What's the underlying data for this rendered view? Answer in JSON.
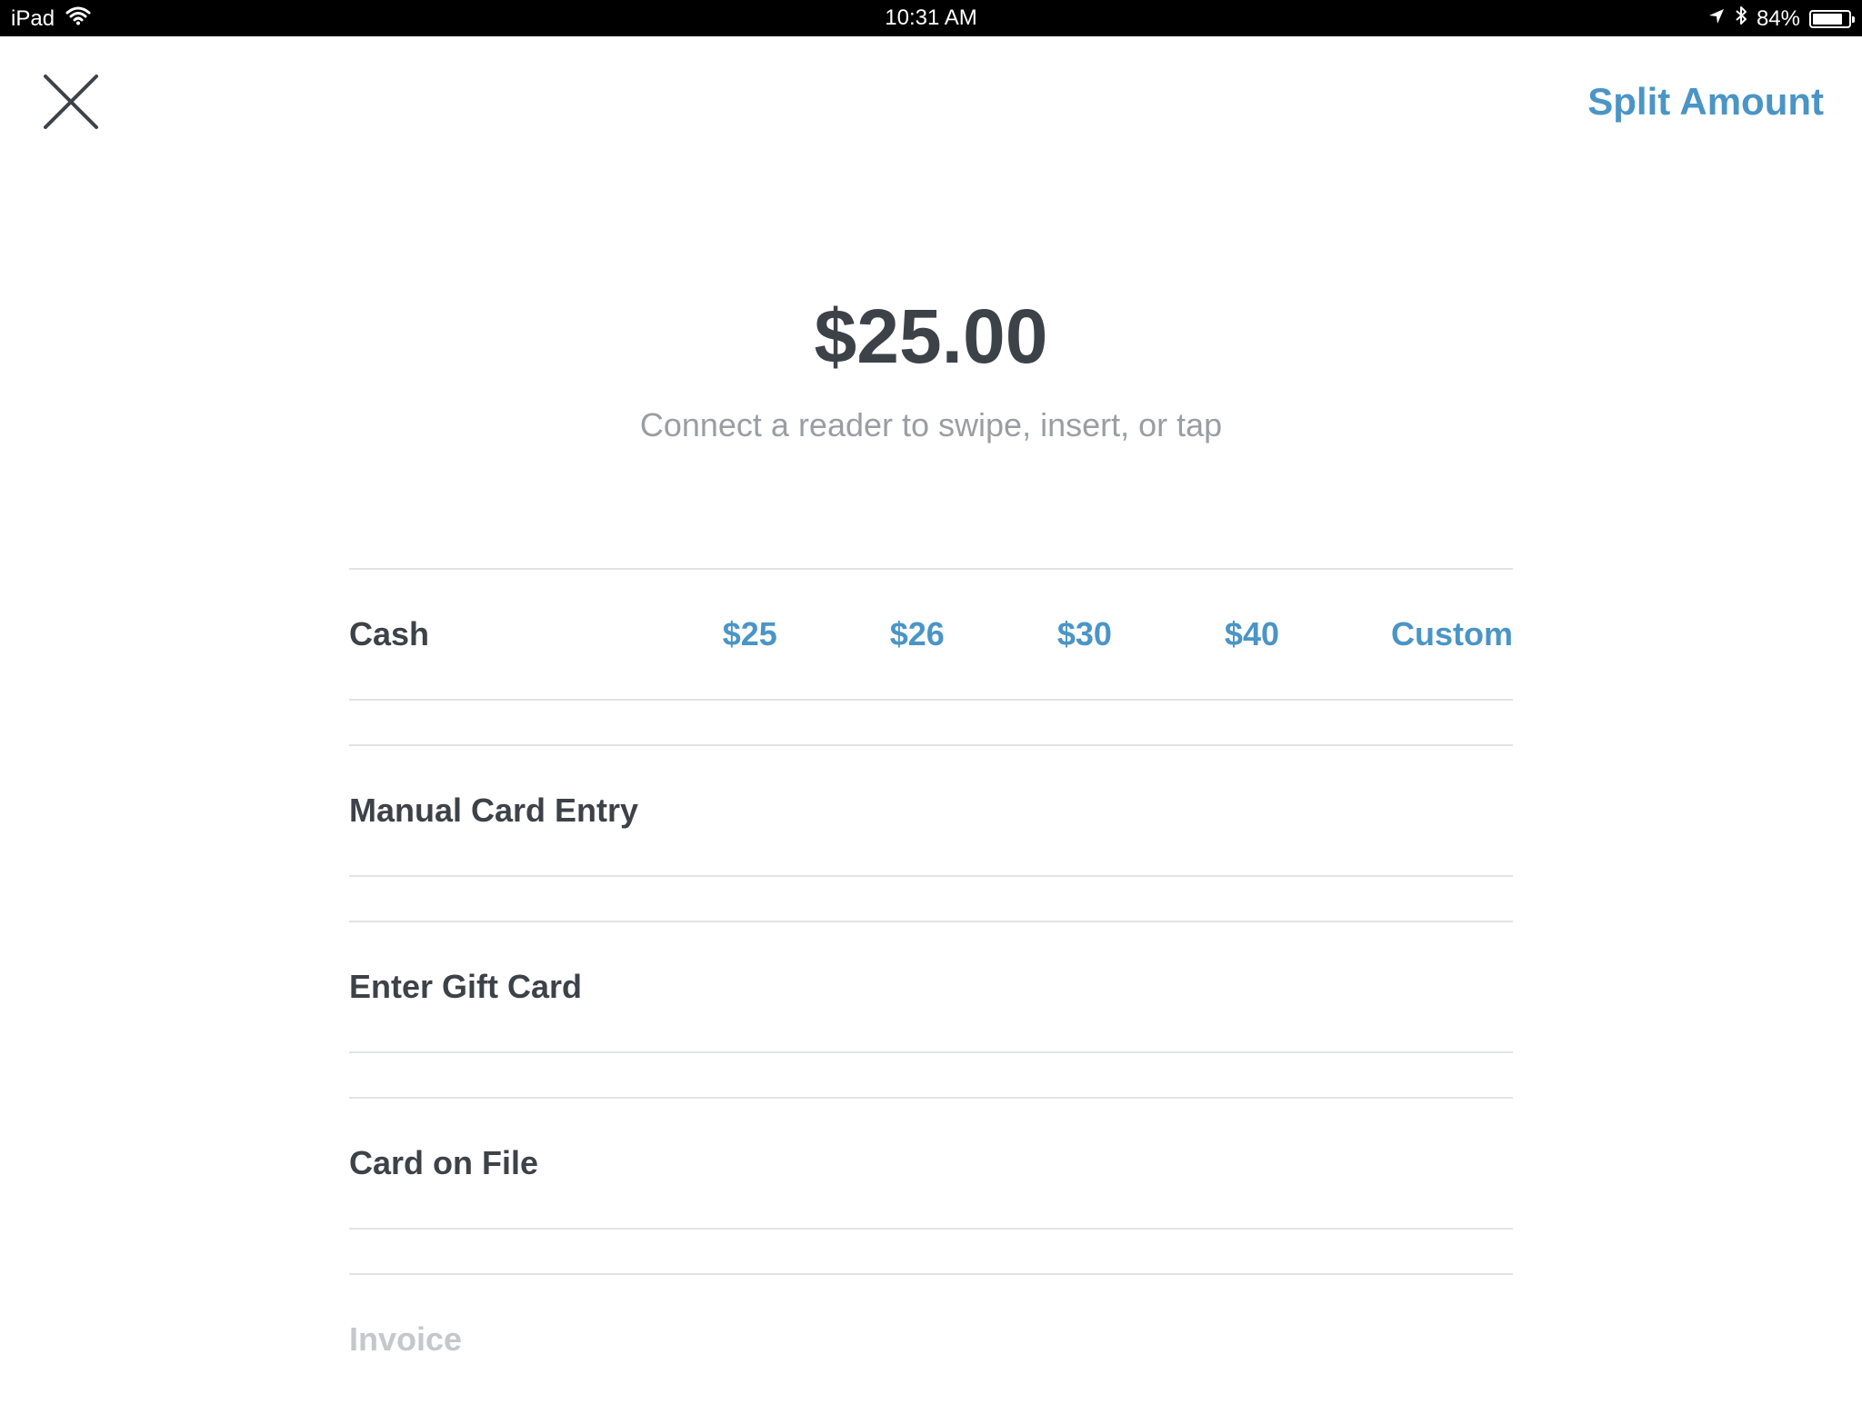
{
  "status_bar": {
    "device": "iPad",
    "time": "10:31 AM",
    "battery_pct": "84%",
    "battery_level": 0.84,
    "icons": [
      "wifi-icon",
      "location-arrow-icon",
      "bluetooth-icon",
      "battery-icon"
    ]
  },
  "header": {
    "close_icon": "close-icon",
    "split_label": "Split Amount"
  },
  "payment": {
    "amount": "$25.00",
    "subtitle": "Connect a reader to swipe, insert, or tap"
  },
  "options": {
    "cash": {
      "label": "Cash",
      "amounts": [
        "$25",
        "$26",
        "$30",
        "$40",
        "Custom"
      ]
    },
    "manual_card": {
      "label": "Manual Card Entry"
    },
    "gift_card": {
      "label": "Enter Gift Card"
    },
    "card_on_file": {
      "label": "Card on File"
    },
    "invoice": {
      "label": "Invoice"
    }
  },
  "colors": {
    "accent": "#4a95c6",
    "text": "#3d4249",
    "muted": "#9a9ea3",
    "disabled": "#c4c7cb",
    "divider": "#e2e3e5"
  }
}
